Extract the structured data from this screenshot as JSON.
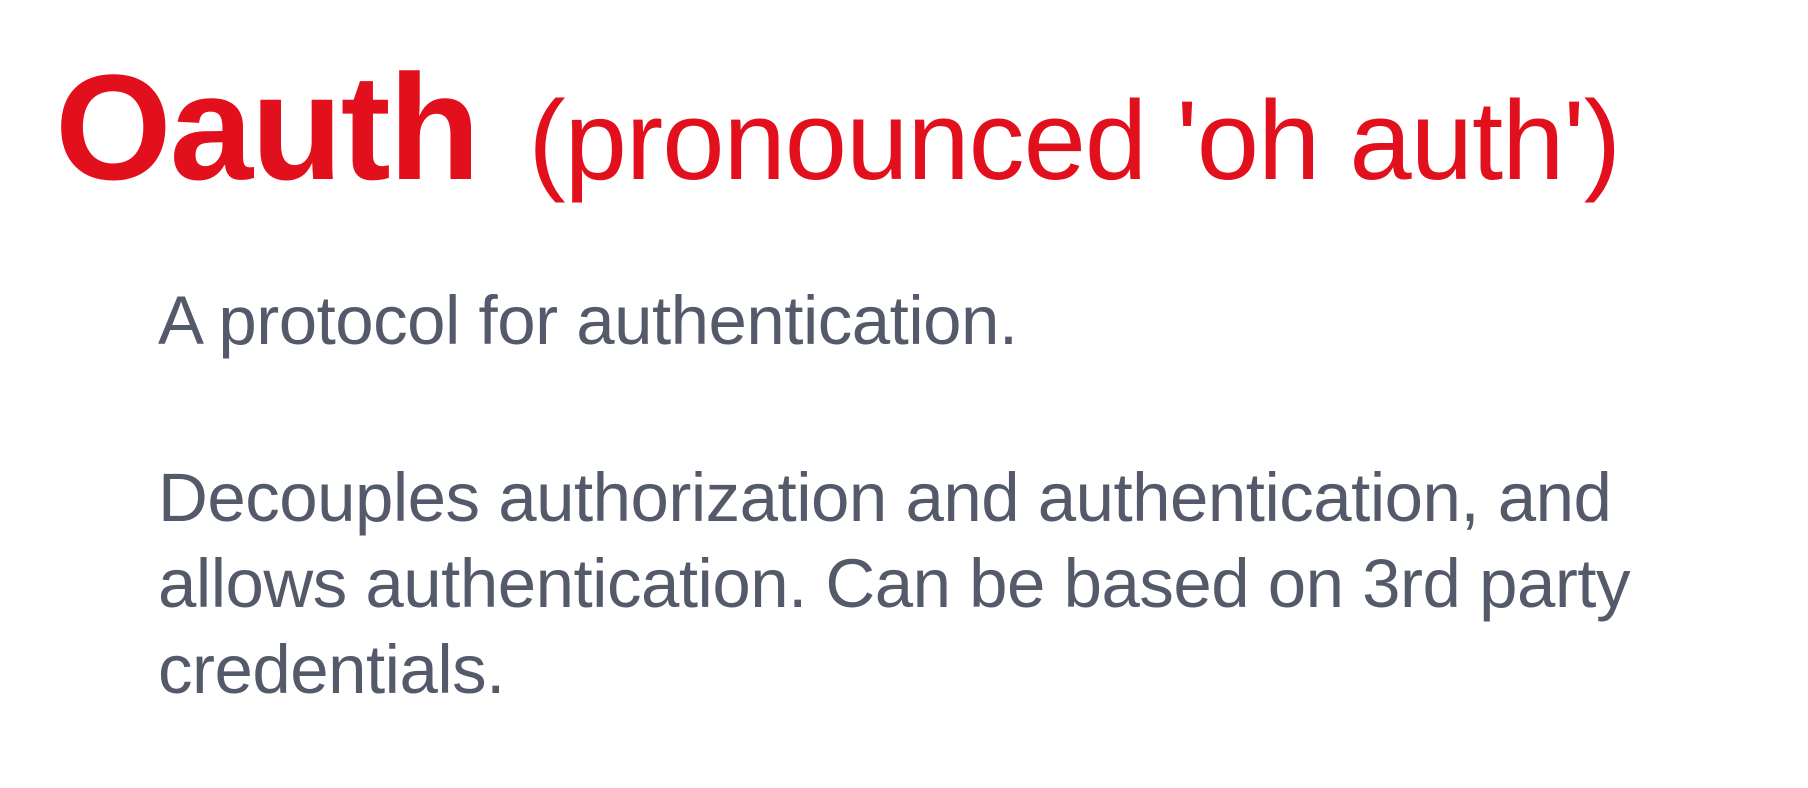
{
  "title": {
    "main": "Oauth",
    "subtitle": "(pronounced 'oh auth')"
  },
  "body": {
    "paragraph_1": "A protocol for authentication.",
    "paragraph_2_lines": [
      "Decouples authorization and authentication, and",
      "allows authentication. Can be based on 3rd party",
      "credentials."
    ]
  },
  "colors": {
    "title": "#e2101c",
    "body_text": "#545a6a",
    "background": "#ffffff"
  }
}
